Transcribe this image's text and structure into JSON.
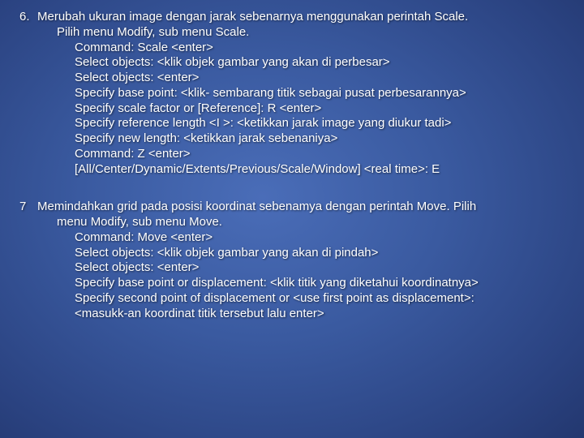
{
  "items": [
    {
      "num": "6.",
      "intro": "Merubah ukuran image dengan jarak sebenarnya menggunakan perintah Scale.",
      "sub": "Pilih menu Modify, sub menu Scale.",
      "commands": [
        "Command: Scale <enter>",
        "Select objects: <klik objek gambar yang akan di perbesar>",
        "Select objects: <enter>",
        "Specify base point: <klik- sembarang titik sebagai pusat perbesarannya>",
        "Specify scale factor or [Reference]: R <enter>",
        "Specify reference length <I >: <ketikkan jarak image yang diukur tadi>",
        "Specify new length: <ketikkan jarak sebenaniya>",
        "Command: Z <enter>",
        "[All/Center/Dynamic/Extents/Previous/Scale/Window] <real time>: E"
      ]
    },
    {
      "num": "7",
      "intro": "Memindahkan grid pada posisi koordinat sebenamya dengan perintah Move. Pilih",
      "sub": "menu Modify, sub menu Move.",
      "commands": [
        "Command: Move <enter>",
        "Select objects: <klik objek gambar yang akan di pindah>",
        "Select objects: <enter>",
        "Specify base point or displacement: <klik titik yang diketahui koordinatnya>",
        "Specify second point of displacement or <use first point as displacement>:",
        "  <masukk-an koordinat titik tersebut lalu enter>"
      ]
    }
  ]
}
